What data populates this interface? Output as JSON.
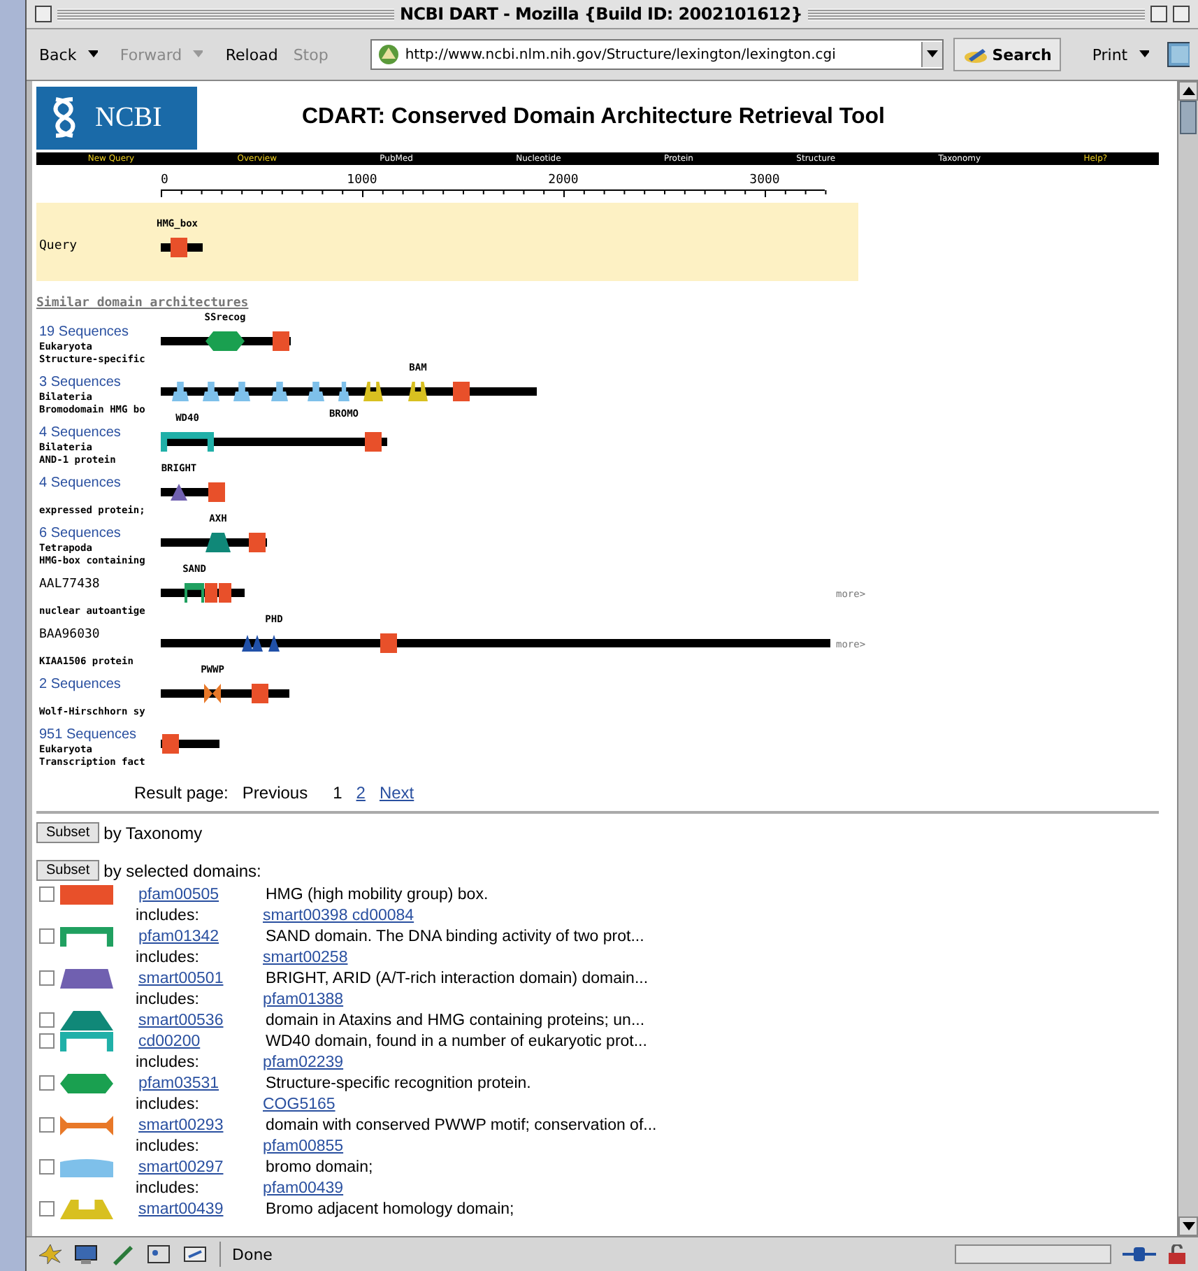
{
  "window": {
    "title": "NCBI DART - Mozilla {Build ID: 2002101612}"
  },
  "toolbar": {
    "buttons": [
      {
        "label": "Back",
        "disabled": false,
        "menu": true
      },
      {
        "label": "Forward",
        "disabled": true,
        "menu": true
      },
      {
        "label": "Reload",
        "disabled": false,
        "menu": false
      },
      {
        "label": "Stop",
        "disabled": true,
        "menu": false
      }
    ],
    "url": "http://www.ncbi.nlm.nih.gov/Structure/lexington/lexington.cgi",
    "search": "Search",
    "print": "Print"
  },
  "header": {
    "logo": "NCBI",
    "title": "CDART: Conserved Domain Architecture Retrieval Tool"
  },
  "nav": [
    {
      "label": "New Query",
      "highlighted": true
    },
    {
      "label": "Overview",
      "highlighted": true
    },
    {
      "label": "PubMed",
      "highlighted": false
    },
    {
      "label": "Nucleotide",
      "highlighted": false
    },
    {
      "label": "Protein",
      "highlighted": false
    },
    {
      "label": "Structure",
      "highlighted": false
    },
    {
      "label": "Taxonomy",
      "highlighted": false
    },
    {
      "label": "Help?",
      "highlighted": true
    }
  ],
  "ruler": {
    "labels": [
      "0",
      "1000",
      "2000",
      "3000"
    ]
  },
  "query": {
    "label": "Query",
    "domains": [
      {
        "kind": "hmg",
        "label": "HMG_box"
      }
    ]
  },
  "similar_heading": "Similar domain architectures",
  "architectures": [
    {
      "label": "19 Sequences",
      "link": true,
      "taxon": "Eukaryota",
      "description": "Structure-specific",
      "domains": [
        {
          "kind": "ssrecog",
          "label": "SSrecog"
        },
        {
          "kind": "hmg"
        }
      ]
    },
    {
      "label": "3 Sequences",
      "link": true,
      "taxon": "Bilateria",
      "description": "Bromodomain HMG bo",
      "domains": [
        {
          "kind": "bromo"
        },
        {
          "kind": "bromo"
        },
        {
          "kind": "bromo"
        },
        {
          "kind": "bromo"
        },
        {
          "kind": "bromo"
        },
        {
          "kind": "bromo",
          "label": "BROMO"
        },
        {
          "kind": "bam"
        },
        {
          "kind": "bam",
          "label": "BAM"
        },
        {
          "kind": "hmg"
        }
      ]
    },
    {
      "label": "4 Sequences",
      "link": true,
      "taxon": "Bilateria",
      "description": "AND-1 protein",
      "domains": [
        {
          "kind": "wd40",
          "label": "WD40"
        },
        {
          "kind": "hmg"
        }
      ]
    },
    {
      "label": "4 Sequences",
      "link": true,
      "description": "expressed protein;",
      "domains": [
        {
          "kind": "bright",
          "label": "BRIGHT"
        },
        {
          "kind": "hmg"
        }
      ]
    },
    {
      "label": "6 Sequences",
      "link": true,
      "taxon": "Tetrapoda",
      "description": "HMG-box containing",
      "domains": [
        {
          "kind": "axh",
          "label": "AXH"
        },
        {
          "kind": "hmg"
        }
      ]
    },
    {
      "label": "AAL77438",
      "link": false,
      "description": "nuclear autoantige",
      "more": "more>",
      "domains": [
        {
          "kind": "sand",
          "label": "SAND"
        },
        {
          "kind": "hmg"
        },
        {
          "kind": "hmg"
        }
      ]
    },
    {
      "label": "BAA96030",
      "link": false,
      "description": "KIAA1506 protein",
      "more": "more>",
      "domains": [
        {
          "kind": "phd"
        },
        {
          "kind": "phd"
        },
        {
          "kind": "phd",
          "label": "PHD"
        },
        {
          "kind": "hmg"
        }
      ]
    },
    {
      "label": "2 Sequences",
      "link": true,
      "description": "Wolf-Hirschhorn sy",
      "domains": [
        {
          "kind": "pwwp",
          "label": "PWWP"
        },
        {
          "kind": "hmg"
        }
      ]
    },
    {
      "label": "951 Sequences",
      "link": true,
      "taxon": "Eukaryota",
      "description": "Transcription fact",
      "domains": [
        {
          "kind": "hmg"
        }
      ]
    }
  ],
  "pager": {
    "label": "Result page:",
    "previous": "Previous",
    "pages": [
      {
        "label": "1",
        "selected": true
      },
      {
        "label": "2",
        "selected": false
      }
    ],
    "next": "Next"
  },
  "subsets": [
    {
      "button": "Subset",
      "label": "by Taxonomy"
    },
    {
      "button": "Subset",
      "label": "by selected domains:"
    }
  ],
  "domain_list": [
    {
      "kind": "hmg",
      "checked": false,
      "accession": "pfam00505",
      "description": "HMG (high mobility group) box.",
      "includes": {
        "label": "includes:",
        "link": "smart00398 cd00084"
      }
    },
    {
      "kind": "sand",
      "checked": false,
      "accession": "pfam01342",
      "description": "SAND domain. The DNA binding activity of two prot...",
      "includes": {
        "label": "includes:",
        "link": "smart00258"
      }
    },
    {
      "kind": "bright",
      "checked": false,
      "accession": "smart00501",
      "description": "BRIGHT, ARID (A/T-rich interaction domain) domain...",
      "includes": {
        "label": "includes:",
        "link": "pfam01388"
      }
    },
    {
      "kind": "axh",
      "checked": false,
      "accession": "smart00536",
      "description": "domain in Ataxins and HMG containing proteins; un..."
    },
    {
      "kind": "wd40",
      "checked": false,
      "accession": "cd00200",
      "description": "WD40 domain, found in a number of eukaryotic prot...",
      "includes": {
        "label": "includes:",
        "link": "pfam02239"
      }
    },
    {
      "kind": "ssrecog",
      "checked": false,
      "accession": "pfam03531",
      "description": "Structure-specific recognition protein.",
      "includes": {
        "label": "includes:",
        "link": "COG5165"
      }
    },
    {
      "kind": "pwwp",
      "checked": false,
      "accession": "smart00293",
      "description": "domain with conserved PWWP motif; conservation of...",
      "includes": {
        "label": "includes:",
        "link": "pfam00855"
      }
    },
    {
      "kind": "bromo",
      "checked": false,
      "accession": "smart00297",
      "description": "bromo domain;",
      "includes": {
        "label": "includes:",
        "link": "pfam00439"
      }
    },
    {
      "kind": "bam",
      "checked": false,
      "accession": "smart00439",
      "description": "Bromo adjacent homology domain;"
    }
  ],
  "status_bar": {
    "text": "Done"
  }
}
